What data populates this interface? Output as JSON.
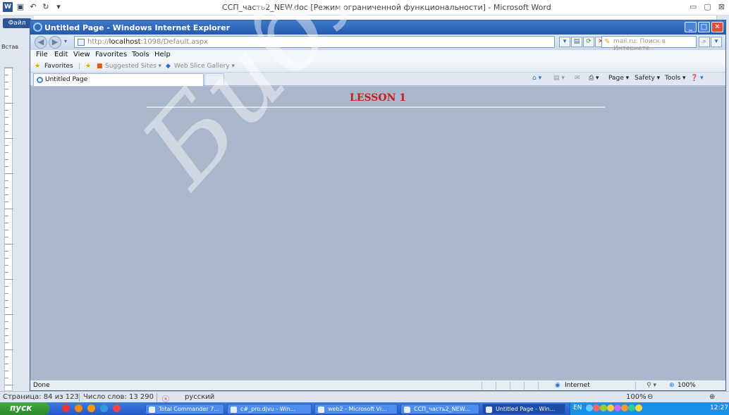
{
  "word": {
    "title": "ССП_часть2_NEW.doc [Режим ограниченной функциональности]  -  Microsoft Word",
    "file_tab": "Файл",
    "paste_label": "Встав",
    "status": {
      "page": "Страница: 84 из 123",
      "words": "Число слов: 13 290",
      "language": "русский",
      "zoom": "100%"
    }
  },
  "ie": {
    "title": "Untitled Page - Windows Internet Explorer",
    "address": {
      "prefix": "http://",
      "host": "localhost",
      "rest": ":1098/Default.aspx"
    },
    "search_placeholder": "mail.ru: Поиск в Интернете",
    "menu": [
      "File",
      "Edit",
      "View",
      "Favorites",
      "Tools",
      "Help"
    ],
    "favorites": {
      "label": "Favorites",
      "suggested": "Suggested Sites ▾",
      "gallery": "Web Slice Gallery ▾"
    },
    "tab_label": "Untitled Page",
    "commands": {
      "page": "Page ▾",
      "safety": "Safety ▾",
      "tools": "Tools ▾"
    },
    "content": {
      "heading": "LESSON 1"
    },
    "status": {
      "text": "Done",
      "zone": "Internet",
      "zoom": "100%"
    }
  },
  "taskbar": {
    "start": "пуск",
    "items": [
      {
        "label": "Total Commander 7..."
      },
      {
        "label": "c#_pro.djvu - Win..."
      },
      {
        "label": "web2 - Microsoft Vi..."
      },
      {
        "label": "ССП_часть2_NEW..."
      },
      {
        "label": "Untitled Page - Win..."
      }
    ],
    "lang": "EN",
    "clock": "12:27"
  },
  "watermark": "Библиотека БГУ"
}
